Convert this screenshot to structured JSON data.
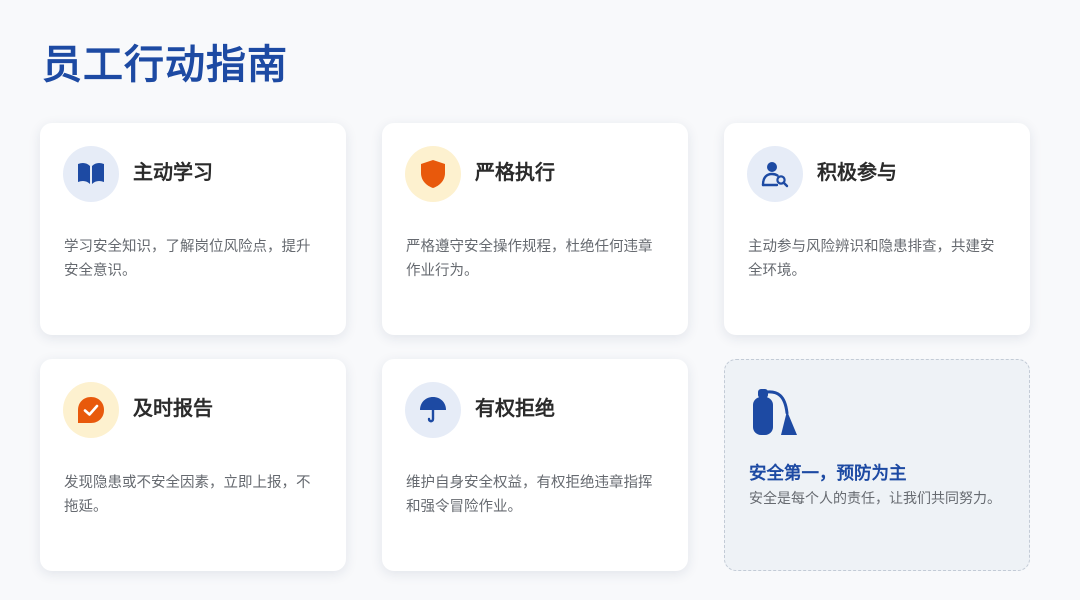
{
  "page": {
    "title": "员工行动指南"
  },
  "cards": [
    {
      "title": "主动学习",
      "desc": "学习安全知识，了解岗位风险点，提升安全意识。",
      "icon": "book-icon"
    },
    {
      "title": "严格执行",
      "desc": "严格遵守安全操作规程，杜绝任何违章作业行为。",
      "icon": "shield-icon"
    },
    {
      "title": "积极参与",
      "desc": "主动参与风险辨识和隐患排查，共建安全环境。",
      "icon": "user-search-icon"
    },
    {
      "title": "及时报告",
      "desc": "发现隐患或不安全因素，立即上报，不拖延。",
      "icon": "report-check-icon"
    },
    {
      "title": "有权拒绝",
      "desc": "维护自身安全权益，有权拒绝违章指挥和强令冒险作业。",
      "icon": "umbrella-icon"
    }
  ],
  "motto": {
    "title": "安全第一，预防为主",
    "desc": "安全是每个人的责任，让我们共同努力。",
    "icon": "fire-extinguisher-icon"
  },
  "colors": {
    "accent": "#1d4aa3",
    "orange": "#e8590c",
    "amber_bg": "#fdf1cf",
    "blue_bg": "#e6ecf7"
  }
}
